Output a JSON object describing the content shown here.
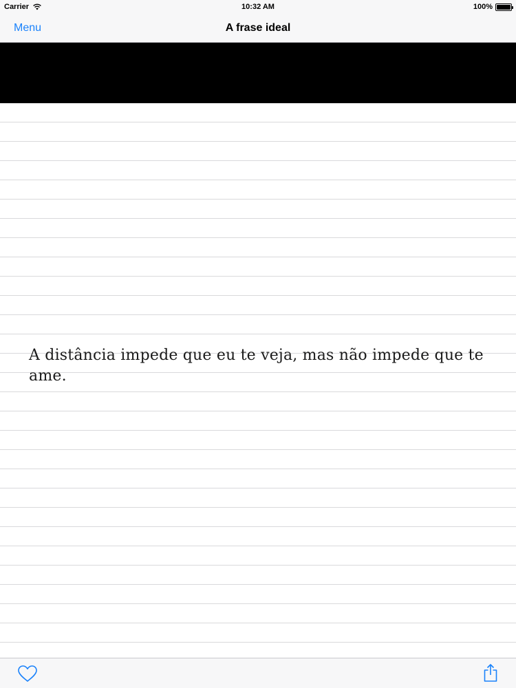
{
  "status_bar": {
    "carrier": "Carrier",
    "time": "10:32 AM",
    "battery": "100%",
    "battery_level": 1.0
  },
  "nav_bar": {
    "back_label": "Menu",
    "title": "A frase ideal"
  },
  "content": {
    "quote": "A distância impede que eu te veja, mas não impede que te ame."
  },
  "toolbar": {
    "favorite_icon": "heart-icon",
    "share_icon": "share-icon"
  },
  "colors": {
    "accent": "#1a82fb",
    "bar_background": "#f7f7f8",
    "banner": "#000000",
    "rule_line": "#d9d9db"
  }
}
